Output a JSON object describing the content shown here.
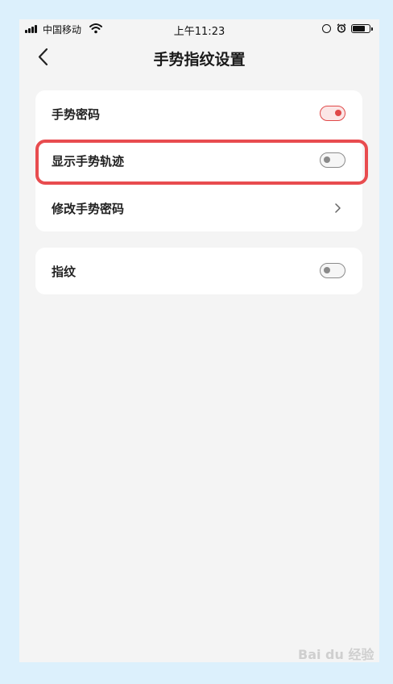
{
  "status_bar": {
    "carrier": "中国移动",
    "time": "上午11:23"
  },
  "nav": {
    "title": "手势指纹设置"
  },
  "settings": {
    "group1": [
      {
        "label": "手势密码",
        "control": "toggle",
        "on": true
      },
      {
        "label": "显示手势轨迹",
        "control": "toggle",
        "on": false
      },
      {
        "label": "修改手势密码",
        "control": "chevron"
      }
    ],
    "group2": [
      {
        "label": "指纹",
        "control": "toggle",
        "on": false
      }
    ]
  },
  "colors": {
    "accent": "#e04848",
    "highlight": "#e84c4f",
    "background": "#f4f4f4",
    "card": "#ffffff",
    "frame": "#dcf0fc"
  },
  "watermark": "Bai du 经验"
}
